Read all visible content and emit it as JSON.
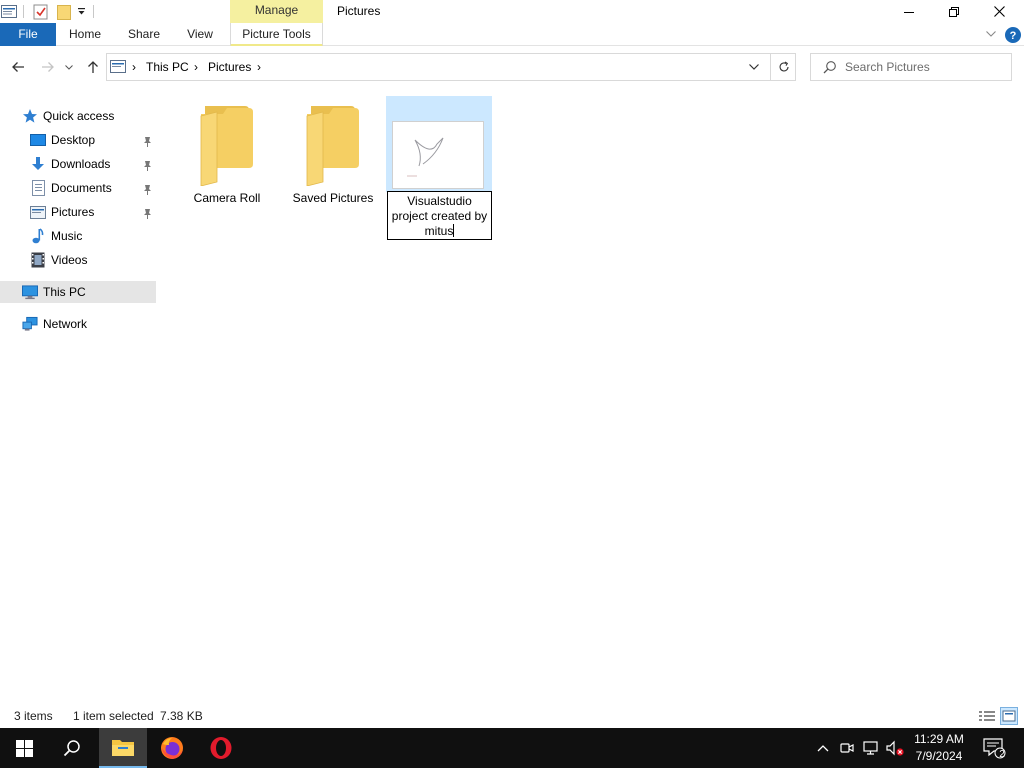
{
  "window": {
    "title": "Pictures",
    "context_tab_group": "Manage"
  },
  "ribbon": {
    "tabs": [
      {
        "label": "File"
      },
      {
        "label": "Home"
      },
      {
        "label": "Share"
      },
      {
        "label": "View"
      },
      {
        "label": "Picture Tools"
      }
    ]
  },
  "address": {
    "crumbs": [
      "This PC",
      "Pictures"
    ]
  },
  "search": {
    "placeholder": "Search Pictures"
  },
  "navpane": {
    "items": [
      {
        "label": "Quick access",
        "icon": "star-icon"
      },
      {
        "label": "Desktop",
        "icon": "desktop-icon",
        "pinned": true
      },
      {
        "label": "Downloads",
        "icon": "download-icon",
        "pinned": true
      },
      {
        "label": "Documents",
        "icon": "documents-icon",
        "pinned": true
      },
      {
        "label": "Pictures",
        "icon": "pictures-icon",
        "pinned": true
      },
      {
        "label": "Music",
        "icon": "music-icon"
      },
      {
        "label": "Videos",
        "icon": "videos-icon"
      },
      {
        "label": "This PC",
        "icon": "computer-icon",
        "selected": true
      },
      {
        "label": "Network",
        "icon": "network-icon"
      }
    ]
  },
  "content": {
    "items": [
      {
        "label": "Camera Roll",
        "type": "folder"
      },
      {
        "label": "Saved Pictures",
        "type": "folder"
      },
      {
        "label": "Visualstudio project created by mitus",
        "type": "image",
        "selected": true,
        "renaming": true,
        "rename_lines": [
          "Visualstudio",
          "project created by",
          "mitus"
        ]
      }
    ]
  },
  "status": {
    "item_count": "3 items",
    "selection": "1 item selected",
    "size": "7.38 KB"
  },
  "taskbar": {
    "time": "11:29 AM",
    "date": "7/9/2024",
    "notification_count": "2"
  },
  "colors": {
    "accent": "#1a69b8",
    "selection": "#cce8ff",
    "manage_tab": "#f5f0a0",
    "folder": "#f8d775",
    "taskbar": "#101010"
  }
}
